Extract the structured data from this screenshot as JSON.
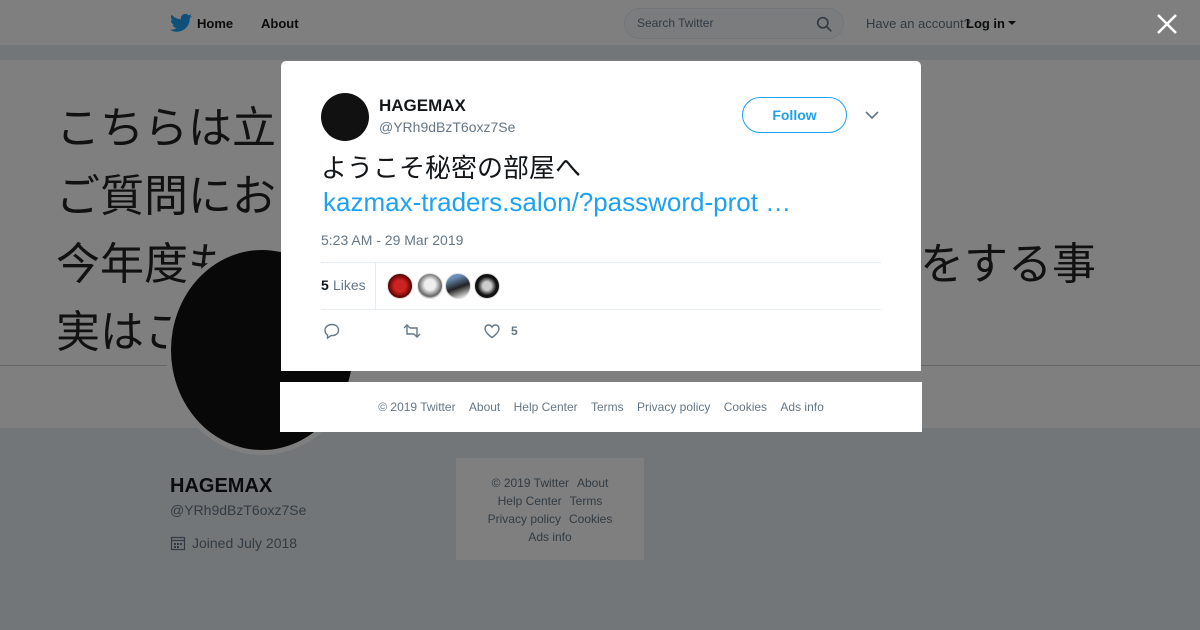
{
  "nav": {
    "home_label": "Home",
    "about_label": "About",
    "search_placeholder": "Search Twitter",
    "have_account": "Have an account?",
    "login_label": "Log in"
  },
  "banner": {
    "lines": [
      "こちらは立",
      "ご質問にお",
      "今年度も",
      "実はこ"
    ],
    "line_tail": "をする事"
  },
  "profile": {
    "name": "HAGEMAX",
    "handle": "@YRh9dBzT6oxz7Se",
    "joined": "Joined July 2018"
  },
  "side_footer": {
    "items": [
      "© 2019 Twitter",
      "About",
      "Help Center",
      "Terms",
      "Privacy policy",
      "Cookies",
      "Ads info"
    ]
  },
  "tweet": {
    "author_name": "HAGEMAX",
    "author_handle": "@YRh9dBzT6oxz7Se",
    "follow_label": "Follow",
    "text": "ようこそ秘密の部屋へ",
    "link": "kazmax-traders.salon/?password-prot …",
    "timestamp": "5:23 AM - 29 Mar 2019",
    "likes_count": "5",
    "likes_label": "Likes",
    "like_action_count": "5"
  },
  "modal_footer": {
    "items": [
      "© 2019 Twitter",
      "About",
      "Help Center",
      "Terms",
      "Privacy policy",
      "Cookies",
      "Ads info"
    ]
  },
  "colors": {
    "accent": "#1da1f2",
    "background": "#e6ecf0",
    "muted_text": "#657786"
  },
  "icons": [
    "twitter-bird-icon",
    "search-icon",
    "caret-down-icon",
    "close-icon",
    "chevron-down-icon",
    "reply-icon",
    "retweet-icon",
    "heart-icon",
    "calendar-icon"
  ]
}
